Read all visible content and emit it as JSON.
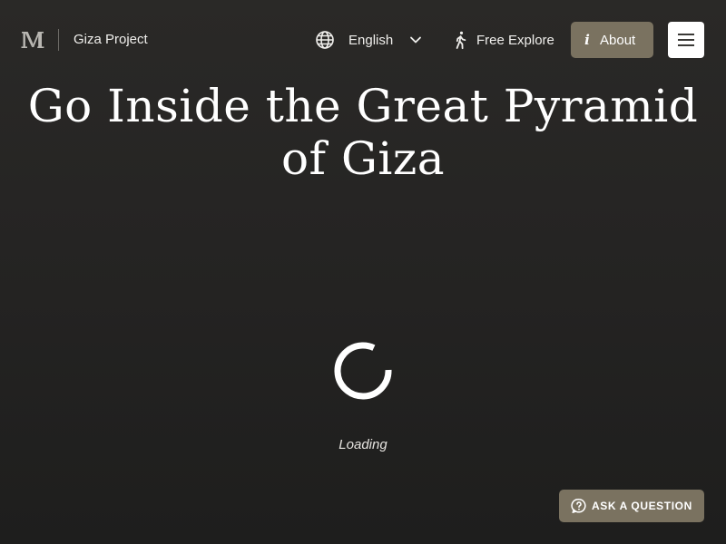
{
  "header": {
    "logo_icon": "museum-m-logo-icon",
    "brand_name": "Giza Project",
    "language": {
      "icon": "globe-icon",
      "selected": "English",
      "chevron_icon": "chevron-down-icon"
    },
    "explore": {
      "icon": "walking-person-icon",
      "label": "Free Explore"
    },
    "about": {
      "icon": "info-icon",
      "icon_glyph": "i",
      "label": "About"
    },
    "menu": {
      "icon": "hamburger-menu-icon"
    }
  },
  "main": {
    "title": "Go Inside the Great Pyramid of Giza",
    "loading_text": "Loading",
    "spinner_icon": "loading-spinner-icon"
  },
  "ask_question": {
    "icon": "question-bubble-icon",
    "label": "ASK A QUESTION"
  },
  "colors": {
    "background": "#252423",
    "accent": "#7a7260",
    "text": "#ffffff"
  }
}
